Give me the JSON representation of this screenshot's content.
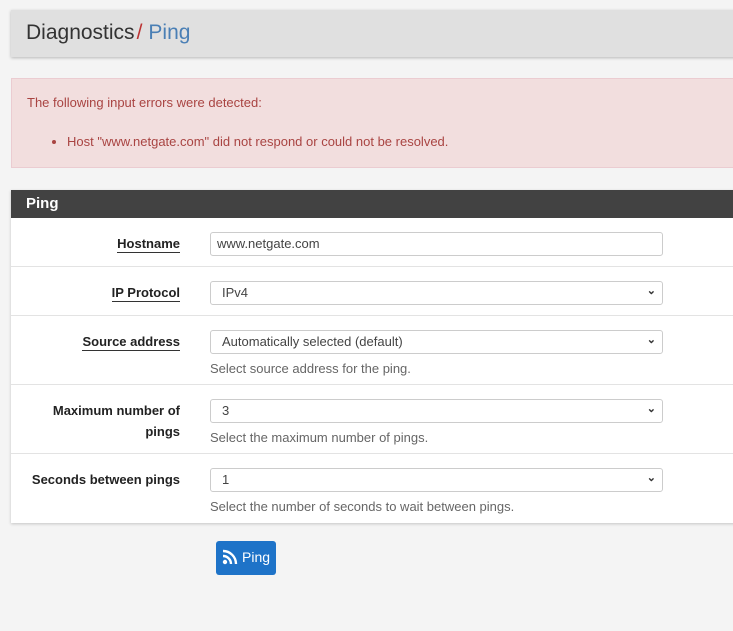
{
  "breadcrumb": {
    "parent": "Diagnostics",
    "separator": "/",
    "current": "Ping"
  },
  "alert": {
    "title": "The following input errors were detected:",
    "errors": [
      "Host \"www.netgate.com\" did not respond or could not be resolved."
    ]
  },
  "panel": {
    "title": "Ping",
    "hostname": {
      "label": "Hostname",
      "value": "www.netgate.com"
    },
    "ip_protocol": {
      "label": "IP Protocol",
      "value": "IPv4"
    },
    "source_address": {
      "label": "Source address",
      "value": "Automatically selected (default)",
      "help": "Select source address for the ping."
    },
    "max_pings": {
      "label": "Maximum number of pings",
      "value": "3",
      "help": "Select the maximum number of pings."
    },
    "seconds_between": {
      "label": "Seconds between pings",
      "value": "1",
      "help": "Select the number of seconds to wait between pings."
    }
  },
  "ping_button": {
    "label": "Ping",
    "icon": "rss-icon",
    "color": "#1e73c8"
  }
}
